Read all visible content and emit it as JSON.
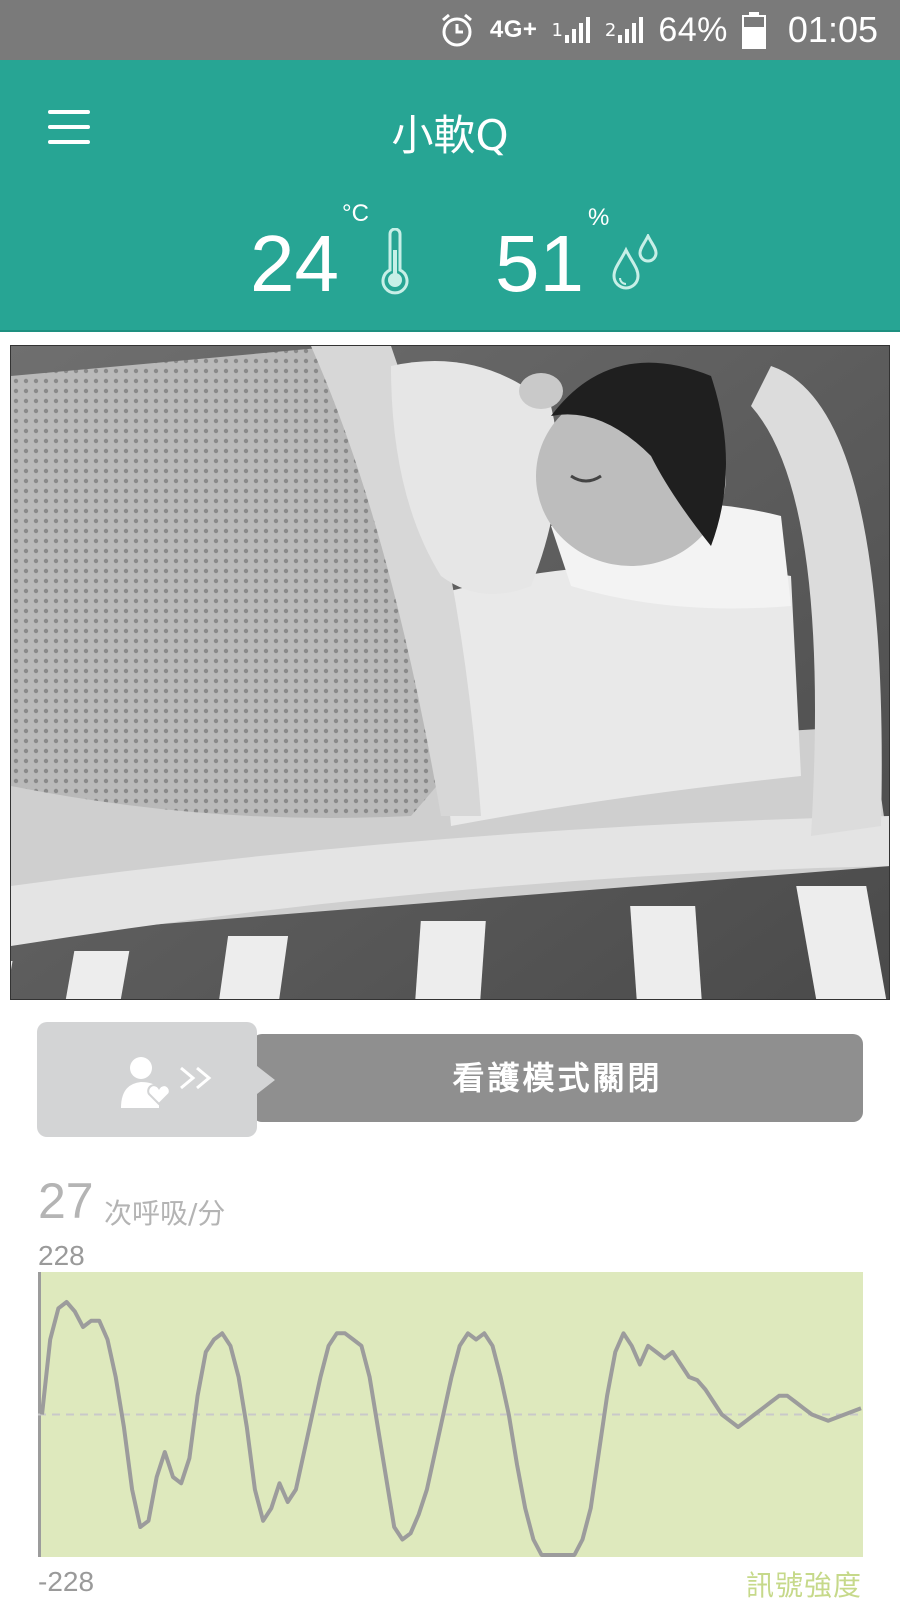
{
  "status_bar": {
    "network": "4G+",
    "sim1": "1",
    "sim2": "2",
    "battery": "64%",
    "time": "01:05"
  },
  "header": {
    "title": "小軟Q"
  },
  "environment": {
    "temperature": "24",
    "temperature_unit": "°C",
    "humidity": "51",
    "humidity_unit": "%"
  },
  "camera": {
    "icon": "sleeping-baby-camera-feed"
  },
  "watch_mode": {
    "label": "看護模式關閉",
    "arrow": ">>"
  },
  "breathing": {
    "rate": "27",
    "unit": "次呼吸/分",
    "y_max_label": "228",
    "y_min_label": "-228",
    "signal_label": "訊號強度"
  },
  "chart_data": {
    "type": "line",
    "ylim": [
      -228,
      228
    ],
    "fill_color": "#dee9bd",
    "line_color": "#9c9c9c",
    "x": [
      0,
      1,
      2,
      3,
      4,
      5,
      6,
      7,
      8,
      9,
      10,
      11,
      12,
      13,
      14,
      15,
      16,
      17,
      18,
      19,
      20,
      21,
      22,
      23,
      24,
      25,
      26,
      27,
      28,
      29,
      30,
      31,
      32,
      33,
      34,
      35,
      36,
      37,
      38,
      39,
      40,
      41,
      42,
      43,
      44,
      45,
      46,
      47,
      48,
      49,
      50,
      51,
      52,
      53,
      54,
      55,
      56,
      57,
      58,
      59,
      60,
      61,
      62,
      63,
      64,
      65,
      66,
      67,
      68,
      69,
      70,
      71,
      72,
      73,
      74,
      75,
      76,
      77,
      78,
      79,
      80,
      81,
      82,
      83,
      84,
      85,
      86,
      87,
      88,
      89,
      90,
      91,
      92,
      93,
      94,
      95,
      96,
      97,
      98,
      99,
      100
    ],
    "series": [
      {
        "values": [
          0,
          120,
          170,
          180,
          165,
          140,
          150,
          150,
          120,
          60,
          -20,
          -120,
          -180,
          -170,
          -100,
          -60,
          -100,
          -110,
          -70,
          30,
          100,
          120,
          130,
          110,
          60,
          -20,
          -120,
          -170,
          -150,
          -110,
          -140,
          -120,
          -60,
          0,
          60,
          110,
          130,
          130,
          120,
          110,
          60,
          -20,
          -100,
          -180,
          -200,
          -190,
          -160,
          -120,
          -60,
          0,
          60,
          110,
          130,
          120,
          130,
          110,
          60,
          0,
          -80,
          -150,
          -200,
          -230,
          -230,
          -230,
          -230,
          -230,
          -200,
          -150,
          -60,
          30,
          100,
          130,
          110,
          80,
          110,
          100,
          90,
          100,
          80,
          60,
          55,
          40,
          20,
          0,
          -10,
          -20,
          -10,
          0,
          10,
          20,
          30,
          30,
          20,
          10,
          0,
          -5,
          -10,
          -5,
          0,
          5,
          10
        ]
      }
    ]
  }
}
